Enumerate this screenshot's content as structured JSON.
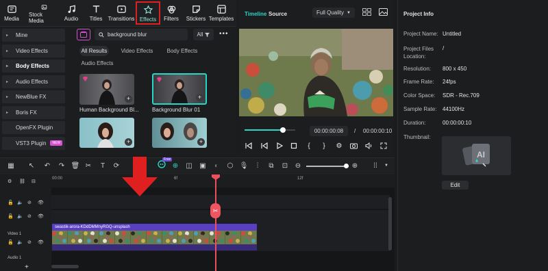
{
  "toolbar": {
    "items": [
      {
        "label": "Media",
        "icon": "media-icon"
      },
      {
        "label": "Stock Media",
        "icon": "stock-media-icon"
      },
      {
        "label": "Audio",
        "icon": "audio-icon"
      },
      {
        "label": "Titles",
        "icon": "titles-icon"
      },
      {
        "label": "Transitions",
        "icon": "transitions-icon"
      },
      {
        "label": "Effects",
        "icon": "effects-icon",
        "active": true
      },
      {
        "label": "Filters",
        "icon": "filters-icon"
      },
      {
        "label": "Stickers",
        "icon": "stickers-icon"
      },
      {
        "label": "Templates",
        "icon": "templates-icon"
      }
    ]
  },
  "effects": {
    "categories": [
      {
        "label": "Mine"
      },
      {
        "label": "Video Effects"
      },
      {
        "label": "Body Effects"
      },
      {
        "label": "Audio Effects"
      },
      {
        "label": "NewBlue FX"
      },
      {
        "label": "Boris FX"
      },
      {
        "label": "OpenFX Plugin"
      },
      {
        "label": "VST3 Plugin",
        "badge": "NEW"
      }
    ],
    "search_value": "background blur",
    "filter_label": "All",
    "tabs": [
      "All Results",
      "Video Effects",
      "Body Effects",
      "Audio Effects"
    ],
    "results": [
      {
        "label": "Human Background Bl..."
      },
      {
        "label": "Background Blur 01"
      }
    ]
  },
  "preview": {
    "tab_timeline": "Timeline",
    "tab_source": "Source",
    "quality": "Full Quality",
    "time_current": "00:00:00:08",
    "time_sep": "/",
    "time_total": "00:00:00:10",
    "progress": 0.75
  },
  "project_info": {
    "title": "Project Info",
    "rows": [
      {
        "key": "Project Name:",
        "value": "Untitled"
      },
      {
        "key": "Project Files Location:",
        "value": "/"
      },
      {
        "key": "Resolution:",
        "value": "800 x 450"
      },
      {
        "key": "Frame Rate:",
        "value": "24fps"
      },
      {
        "key": "Color Space:",
        "value": "SDR - Rec.709"
      },
      {
        "key": "Sample Rate:",
        "value": "44100Hz"
      },
      {
        "key": "Duration:",
        "value": "00:00:00:10"
      }
    ],
    "thumbnail_label": "Thumbnail:",
    "edit_label": "Edit"
  },
  "timeline": {
    "ruler": [
      "00:00",
      "6f",
      "12f"
    ],
    "clip_name": "swastik-arora-KDdDMMnyRGQ-unsplash",
    "track_video_label": "Video 1",
    "track_audio_label": "Audio 1",
    "ai_badge": "Free"
  },
  "colors": {
    "accent": "#29d6c8",
    "playhead": "#f04e5a",
    "clip": "#5b3fc2",
    "highlight_box": "#e02020"
  }
}
